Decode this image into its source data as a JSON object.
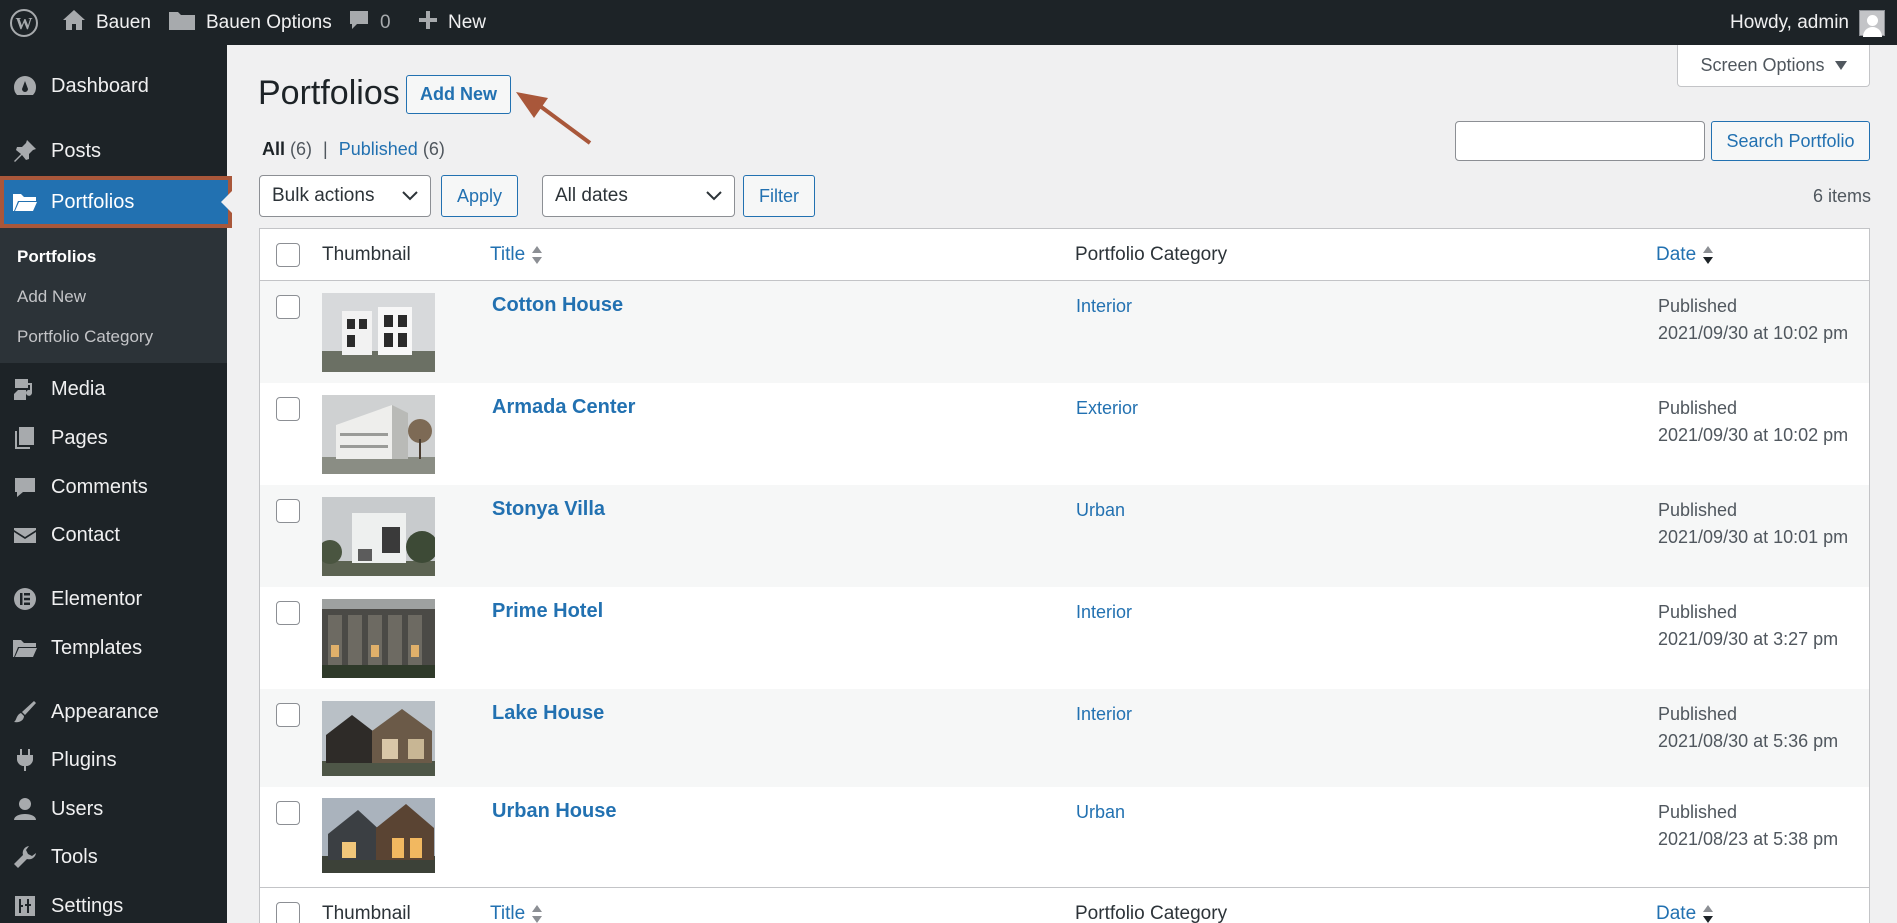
{
  "adminbar": {
    "site_name": "Bauen",
    "options_label": "Bauen Options",
    "comment_count": "0",
    "new_label": "New",
    "greeting": "Howdy, admin"
  },
  "sidebar": {
    "items": [
      {
        "label": "Dashboard",
        "icon": "dashboard-icon"
      },
      {
        "label": "Posts",
        "icon": "pin-icon"
      },
      {
        "label": "Portfolios",
        "icon": "folder-icon"
      },
      {
        "label": "Media",
        "icon": "media-icon"
      },
      {
        "label": "Pages",
        "icon": "pages-icon"
      },
      {
        "label": "Comments",
        "icon": "comment-icon"
      },
      {
        "label": "Contact",
        "icon": "mail-icon"
      },
      {
        "label": "Elementor",
        "icon": "elementor-icon"
      },
      {
        "label": "Templates",
        "icon": "folder-icon"
      },
      {
        "label": "Appearance",
        "icon": "brush-icon"
      },
      {
        "label": "Plugins",
        "icon": "plug-icon"
      },
      {
        "label": "Users",
        "icon": "user-icon"
      },
      {
        "label": "Tools",
        "icon": "wrench-icon"
      },
      {
        "label": "Settings",
        "icon": "settings-icon"
      }
    ],
    "submenu": [
      "Portfolios",
      "Add New",
      "Portfolio Category"
    ]
  },
  "page": {
    "title": "Portfolios",
    "add_new": "Add New",
    "screen_options": "Screen Options",
    "filter_all": "All",
    "filter_all_count": "(6)",
    "filter_sep": "|",
    "filter_published": "Published",
    "filter_published_count": "(6)",
    "search_button": "Search Portfolio",
    "bulk_actions": "Bulk actions",
    "apply": "Apply",
    "all_dates": "All dates",
    "filter": "Filter",
    "items_count": "6 items"
  },
  "table": {
    "columns": {
      "thumbnail": "Thumbnail",
      "title": "Title",
      "category": "Portfolio Category",
      "date": "Date"
    },
    "rows": [
      {
        "title": "Cotton House",
        "category": "Interior",
        "status": "Published",
        "date": "2021/09/30 at 10:02 pm"
      },
      {
        "title": "Armada Center",
        "category": "Exterior",
        "status": "Published",
        "date": "2021/09/30 at 10:02 pm"
      },
      {
        "title": "Stonya Villa",
        "category": "Urban",
        "status": "Published",
        "date": "2021/09/30 at 10:01 pm"
      },
      {
        "title": "Prime Hotel",
        "category": "Interior",
        "status": "Published",
        "date": "2021/09/30 at 3:27 pm"
      },
      {
        "title": "Lake House",
        "category": "Interior",
        "status": "Published",
        "date": "2021/08/30 at 5:36 pm"
      },
      {
        "title": "Urban House",
        "category": "Urban",
        "status": "Published",
        "date": "2021/08/23 at 5:38 pm"
      }
    ]
  },
  "colors": {
    "accent": "#2271b1",
    "adminbar": "#1d2327",
    "highlight_border": "#a9573a"
  }
}
